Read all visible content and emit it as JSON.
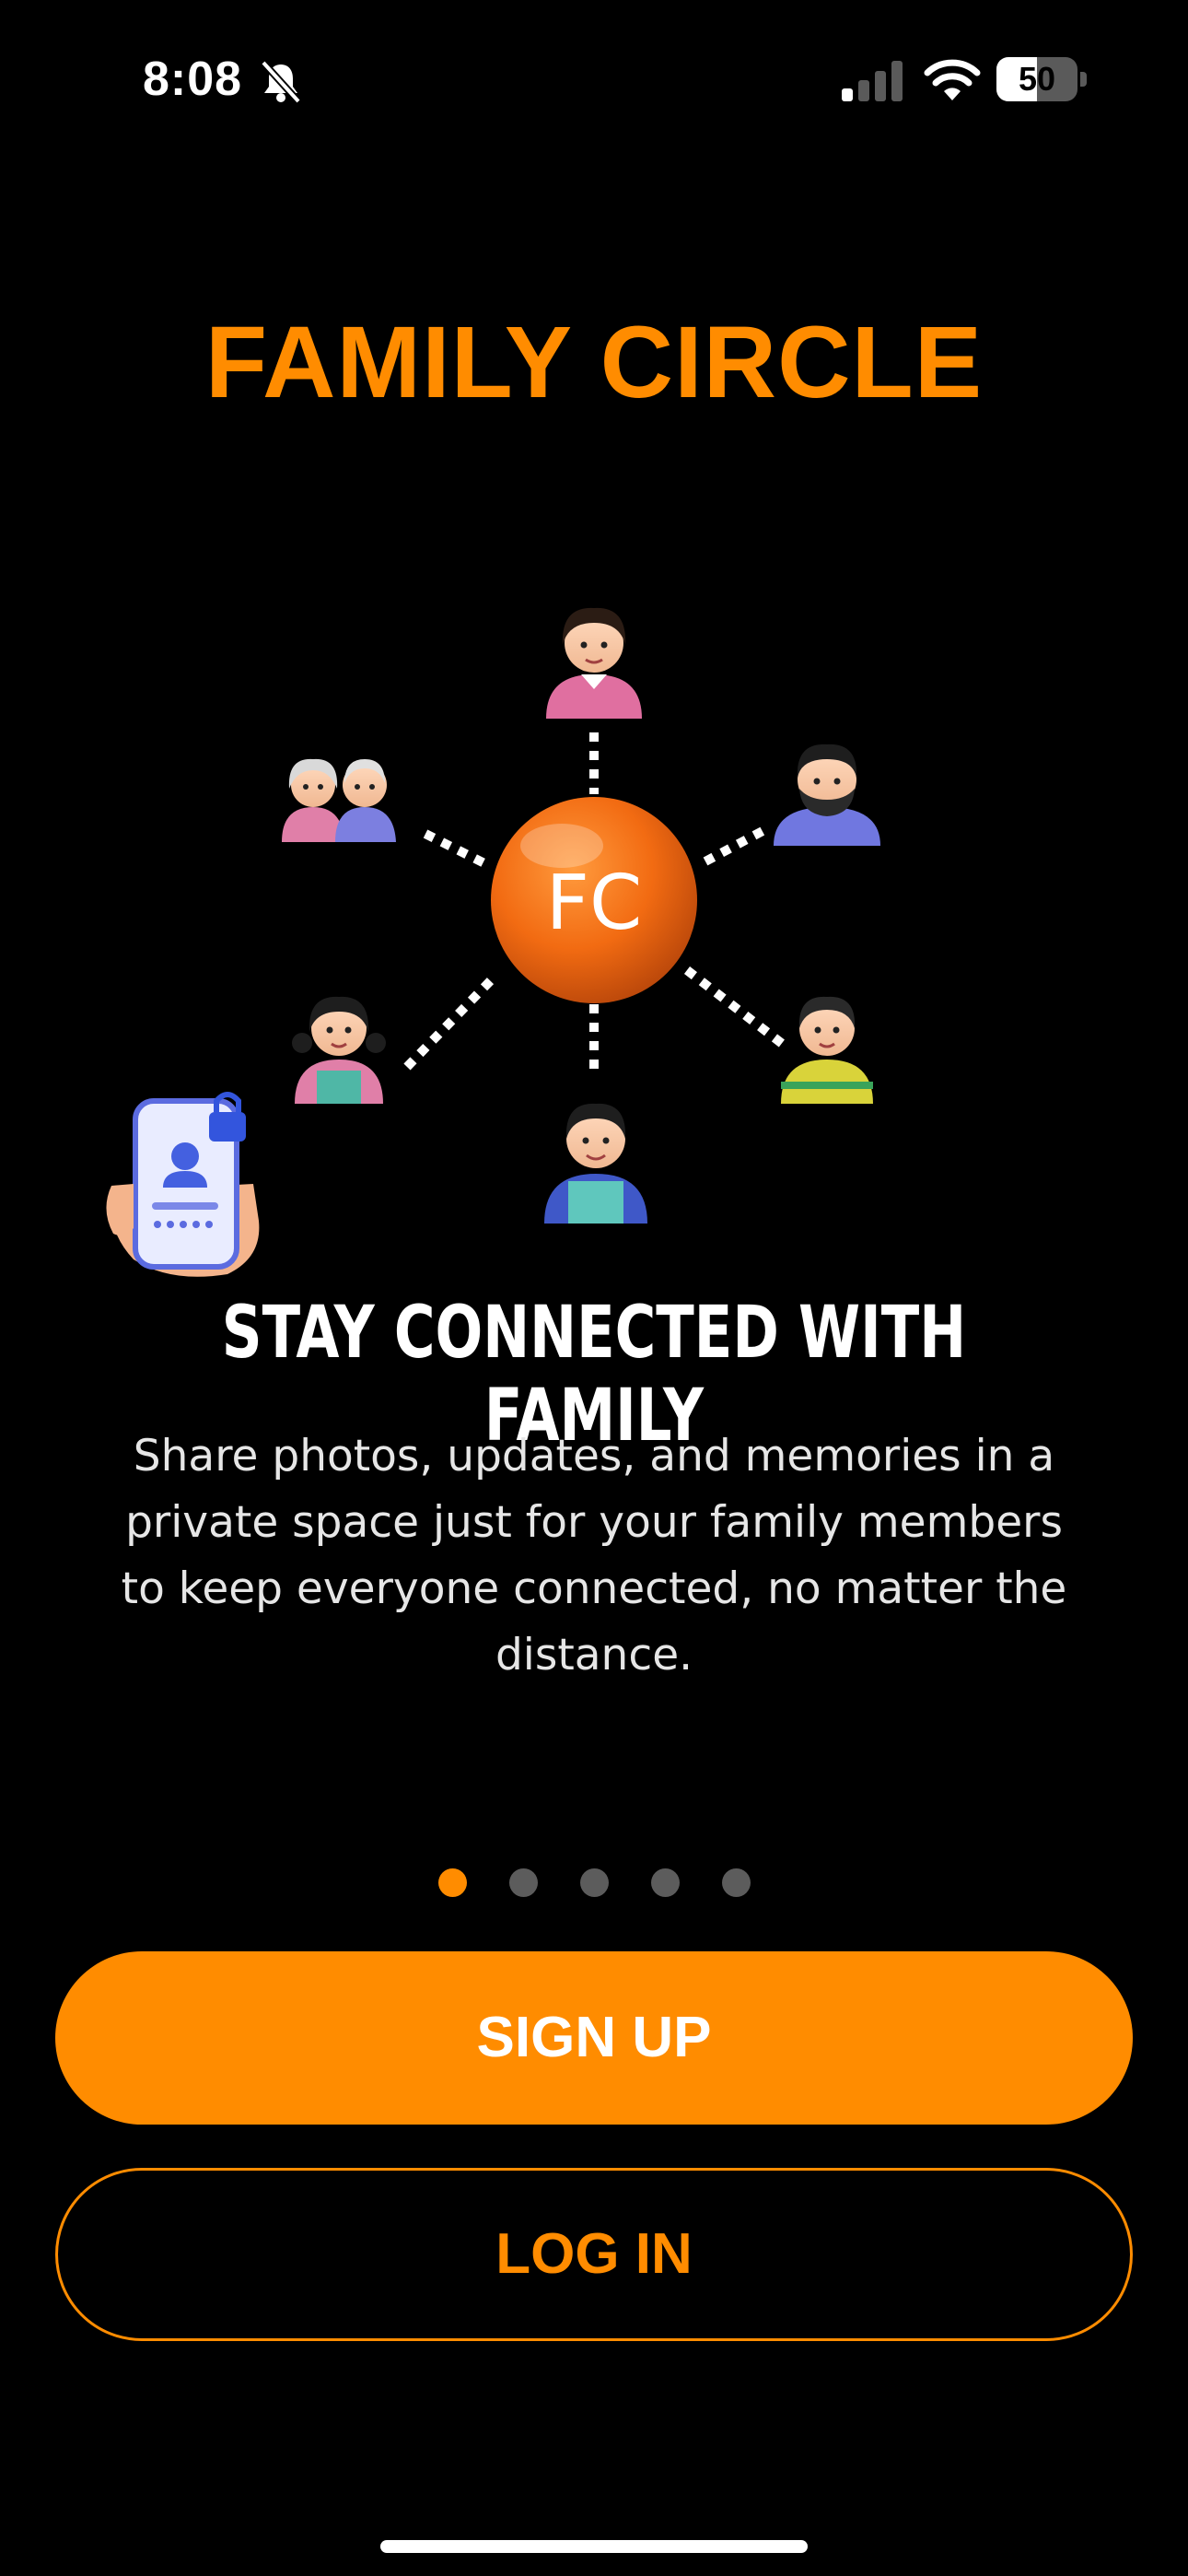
{
  "status_bar": {
    "time": "8:08",
    "battery_level": "50",
    "battery_fraction": 0.5,
    "icons": [
      "bell-off-icon",
      "signal-icon",
      "wifi-icon",
      "battery-icon"
    ]
  },
  "app_title": "FAMILY CIRCLE",
  "illustration": {
    "center_label": "FC",
    "figures": [
      "woman",
      "grandparents",
      "bearded-man",
      "girl",
      "boy",
      "man",
      "phone-login"
    ]
  },
  "slide": {
    "heading": "STAY CONNECTED WITH FAMILY",
    "body": "Share photos, updates, and memories in a private space just for your family members to keep everyone connected, no matter the distance."
  },
  "pager": {
    "total": 5,
    "active_index": 0
  },
  "buttons": {
    "signup_label": "SIGN UP",
    "login_label": "LOG IN"
  },
  "colors": {
    "accent": "#ff8c00",
    "background": "#000000",
    "inactive_dot": "#5c5c5c"
  }
}
